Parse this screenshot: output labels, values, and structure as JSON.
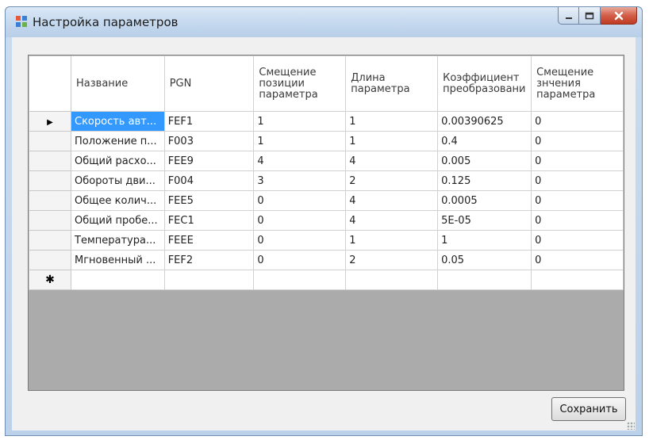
{
  "window": {
    "title": "Настройка параметров"
  },
  "grid": {
    "columns": [
      "Название",
      "PGN",
      "Смещение позиции параметра",
      "Длина параметра",
      "Коэффициент преобразовани",
      "Смещение знчения параметра"
    ],
    "rows": [
      [
        "Скорость авт...",
        "FEF1",
        "1",
        "1",
        "0.00390625",
        "0"
      ],
      [
        "Положение п...",
        "F003",
        "1",
        "1",
        "0.4",
        "0"
      ],
      [
        "Общий расхо...",
        "FEE9",
        "4",
        "4",
        "0.005",
        "0"
      ],
      [
        "Обороты дви...",
        "F004",
        "3",
        "2",
        "0.125",
        "0"
      ],
      [
        "Общее колич...",
        "FEE5",
        "0",
        "4",
        "0.0005",
        "0"
      ],
      [
        "Общий пробе...",
        "FEC1",
        "0",
        "4",
        "5E-05",
        "0"
      ],
      [
        "Температура...",
        "FEEE",
        "0",
        "1",
        "1",
        "0"
      ],
      [
        "Мгновенный ...",
        "FEF2",
        "0",
        "2",
        "0.05",
        "0"
      ]
    ],
    "current_row_marker": "▶",
    "new_row_marker": "✱"
  },
  "buttons": {
    "save_label": "Сохранить"
  },
  "colors": {
    "selection": "#3399ff",
    "grid_background": "#ababab",
    "close_button": "#c8432b"
  },
  "icons": {
    "app": "form-icon",
    "minimize": "minimize-icon",
    "maximize": "maximize-icon",
    "close": "close-icon"
  }
}
